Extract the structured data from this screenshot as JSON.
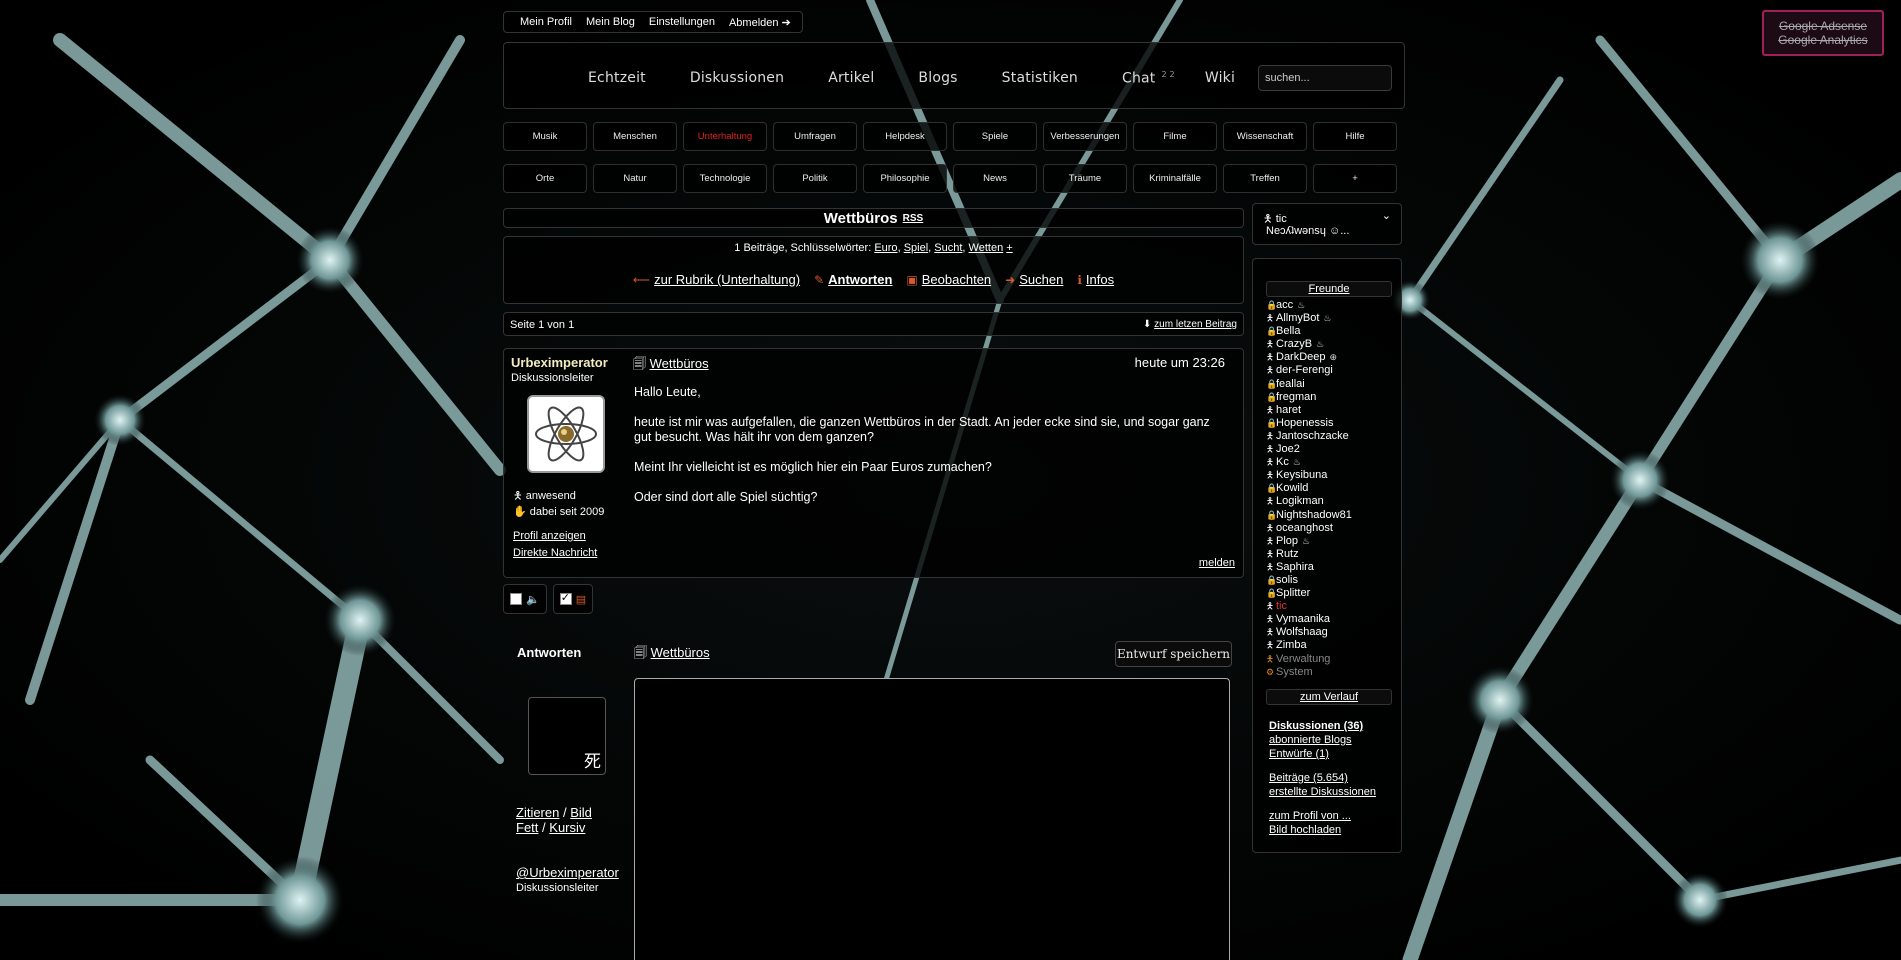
{
  "userbar": {
    "items": [
      "Mein Profil",
      "Mein Blog",
      "Einstellungen",
      "Abmelden ➔"
    ]
  },
  "google": {
    "line1": "Google Adsense",
    "line2": "Google Analytics"
  },
  "nav": {
    "items": [
      "Echtzeit",
      "Diskussionen",
      "Artikel",
      "Blogs",
      "Statistiken",
      "Chat",
      "Wiki"
    ],
    "chat_badge": "2 2",
    "search_placeholder": "suchen..."
  },
  "categories": {
    "row1": [
      "Musik",
      "Menschen",
      "Unterhaltung",
      "Umfragen",
      "Helpdesk",
      "Spiele",
      "Verbesserungen",
      "Filme",
      "Wissenschaft",
      "Hilfe"
    ],
    "row2": [
      "Orte",
      "Natur",
      "Technologie",
      "Politik",
      "Philosophie",
      "News",
      "Träume",
      "Kriminalfälle",
      "Treffen",
      "+"
    ],
    "active": "Unterhaltung",
    "active_color": "#e02222"
  },
  "thread": {
    "title": "Wettbüros",
    "rss": "RSS",
    "meta_prefix": "1 Beiträge, Schlüsselwörter:",
    "keywords": [
      "Euro",
      "Spiel",
      "Sucht",
      "Wetten",
      "+"
    ],
    "actions": {
      "back": "zur Rubrik (Unterhaltung)",
      "reply": "Antworten",
      "watch": "Beobachten",
      "search": "Suchen",
      "info": "Infos"
    },
    "page_info": "Seite 1 von 1",
    "last_post": "zum letzen Beitrag"
  },
  "post": {
    "author": "Urbeximperator",
    "role": "Diskussionsleiter",
    "status": "anwesend",
    "since": "dabei seit 2009",
    "profile_link": "Profil anzeigen",
    "message_link": "Direkte Nachricht",
    "title": "Wettbüros",
    "time": "heute um 23:26",
    "paragraphs": [
      "Hallo Leute,",
      "heute ist mir was aufgefallen, die ganzen Wettbüros in der Stadt. An jeder ecke sind sie, und sogar ganz gut besucht. Was hält ihr von dem ganzen?",
      "Meint Ihr vielleicht ist es möglich hier ein Paar Euros zumachen?",
      "Oder sind dort alle Spiel süchtig?"
    ],
    "report": "melden"
  },
  "reply": {
    "heading": "Antworten",
    "avatar_glyph": "死",
    "quote": "Zitieren",
    "image": "Bild",
    "bold": "Fett",
    "italic": "Kursiv",
    "sep": "/",
    "mention": "@Urbeximperator",
    "mention_role": "Diskussionsleiter",
    "title": "Wettbüros",
    "draft_button": "Entwurf speichern"
  },
  "sidebar": {
    "user_name": "tic",
    "user_status": "Neɔʎʇwǝnsɥ ☺...",
    "friends_header": "Freunde",
    "friends": [
      {
        "name": "acc",
        "online": false,
        "extra": "♨"
      },
      {
        "name": "AllmyBot",
        "online": true,
        "extra": "♨"
      },
      {
        "name": "Bella",
        "online": false,
        "extra": ""
      },
      {
        "name": "CrazyB",
        "online": true,
        "extra": "♨"
      },
      {
        "name": "DarkDeep",
        "online": true,
        "extra": "⊕"
      },
      {
        "name": "der-Ferengi",
        "online": true,
        "extra": ""
      },
      {
        "name": "feallai",
        "online": false,
        "extra": ""
      },
      {
        "name": "fregman",
        "online": false,
        "extra": ""
      },
      {
        "name": "haret",
        "online": true,
        "extra": ""
      },
      {
        "name": "Hopenessis",
        "online": false,
        "extra": ""
      },
      {
        "name": "Jantoschzacke",
        "online": true,
        "extra": ""
      },
      {
        "name": "Joe2",
        "online": true,
        "extra": ""
      },
      {
        "name": "Kc",
        "online": true,
        "extra": "♨"
      },
      {
        "name": "Keysibuna",
        "online": true,
        "extra": ""
      },
      {
        "name": "Kowild",
        "online": false,
        "extra": ""
      },
      {
        "name": "Logikman",
        "online": true,
        "extra": ""
      },
      {
        "name": "Nightshadow81",
        "online": false,
        "extra": ""
      },
      {
        "name": "oceanghost",
        "online": true,
        "extra": ""
      },
      {
        "name": "Plop",
        "online": true,
        "extra": "♨"
      },
      {
        "name": "Rutz",
        "online": true,
        "extra": ""
      },
      {
        "name": "Saphira",
        "online": true,
        "extra": ""
      },
      {
        "name": "solis",
        "online": false,
        "extra": ""
      },
      {
        "name": "Splitter",
        "online": false,
        "extra": ""
      },
      {
        "name": "tic",
        "online": true,
        "extra": "",
        "self": true
      },
      {
        "name": "Vymaanika",
        "online": true,
        "extra": ""
      },
      {
        "name": "Wolfshaag",
        "online": true,
        "extra": ""
      },
      {
        "name": "Zimba",
        "online": true,
        "extra": ""
      },
      {
        "name": "Verwaltung",
        "online": true,
        "extra": "",
        "system": true
      },
      {
        "name": "System",
        "online": true,
        "extra": "",
        "system": true
      }
    ],
    "history_header": "zum Verlauf",
    "links": {
      "discussions": "Diskussionen (36)",
      "blogs": "abonnierte Blogs",
      "drafts": "Entwürfe (1)",
      "posts": "Beiträge (5.654)",
      "created": "erstellte Diskussionen",
      "profile": "zum Profil von ...",
      "upload": "Bild hochladen"
    }
  }
}
